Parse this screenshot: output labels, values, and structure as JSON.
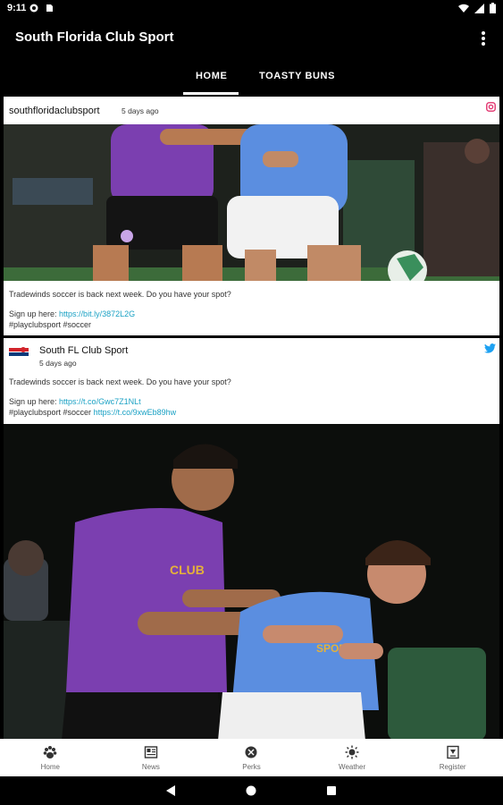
{
  "status_bar": {
    "time": "9:11",
    "icons": [
      "pocket-casts-icon",
      "sd-card-icon",
      "wifi-icon",
      "signal-icon",
      "battery-icon"
    ]
  },
  "app_bar": {
    "title": "South Florida Club Sport",
    "overflow_icon": "more-vert-icon"
  },
  "tabs": [
    {
      "label": "HOME",
      "selected": true
    },
    {
      "label": "TOASTY BUNS",
      "selected": false
    }
  ],
  "feed": {
    "instagram_post": {
      "username": "southfloridaclubsport",
      "time_ago": "5 days ago",
      "source_icon": "instagram-icon",
      "text_line1": "Tradewinds soccer is back next week.  Do you have your spot?",
      "signup_prefix": "Sign up here: ",
      "signup_link": "https://bit.ly/3872L2G",
      "hashtags": "#playclubsport #soccer"
    },
    "twitter_post": {
      "username": "South FL Club Sport",
      "time_ago": "5 days ago",
      "source_icon": "twitter-bird-icon",
      "text_line1": "Tradewinds soccer is back next week.  Do you have your spot?",
      "signup_prefix": "Sign up here: ",
      "signup_link": "https://t.co/Gwc7Z1NLt",
      "hashtags": "#playclubsport #soccer ",
      "media_link": "https://t.co/9xwEb89hw"
    }
  },
  "bottom_nav": [
    {
      "label": "Home",
      "icon": "paw-icon"
    },
    {
      "label": "News",
      "icon": "newspaper-icon"
    },
    {
      "label": "Perks",
      "icon": "perks-icon"
    },
    {
      "label": "Weather",
      "icon": "sun-icon"
    },
    {
      "label": "Register",
      "icon": "register-icon"
    }
  ],
  "colors": {
    "link": "#1aa1c4",
    "jersey_purple": "#7b3fb0",
    "jersey_blue": "#5b8ee0",
    "twitter_blue": "#1da1f2"
  }
}
